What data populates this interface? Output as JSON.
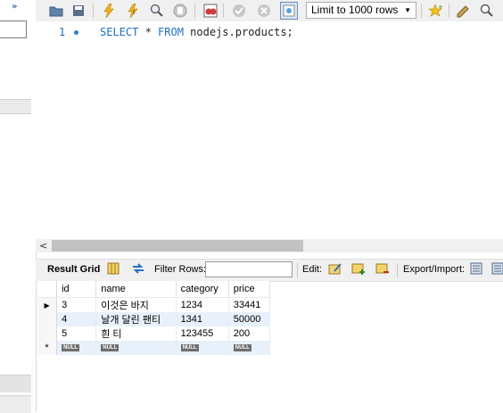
{
  "toolbar": {
    "limit_select": "Limit to 1000 rows",
    "icons": [
      "open-folder-icon",
      "save-icon",
      "execute-icon",
      "execute-current-icon",
      "explain-icon",
      "stop-icon",
      "toggle-error-icon",
      "commit-icon",
      "rollback-icon",
      "autocommit-icon",
      "bookmark-icon",
      "beautify-icon",
      "find-icon"
    ]
  },
  "sidebar": {
    "collapse_glyph": "»"
  },
  "editor": {
    "line_number": "1",
    "tokens": {
      "select": "SELECT",
      "star": " * ",
      "from": "FROM",
      "target": " nodejs.products;"
    }
  },
  "results_toolbar": {
    "result_grid": "Result Grid",
    "filter_rows": "Filter Rows:",
    "filter_value": "",
    "edit": "Edit:",
    "export_import": "Export/Import:"
  },
  "grid": {
    "columns": [
      "id",
      "name",
      "category",
      "price"
    ],
    "rows": [
      {
        "id": "3",
        "name": "이것은 바지",
        "category": "1234",
        "price": "33441"
      },
      {
        "id": "4",
        "name": "날개 달린 팬티",
        "category": "1341",
        "price": "50000"
      },
      {
        "id": "5",
        "name": "흰 티",
        "category": "123455",
        "price": "200"
      }
    ],
    "null_label": "NULL",
    "new_row_marker": "*"
  }
}
